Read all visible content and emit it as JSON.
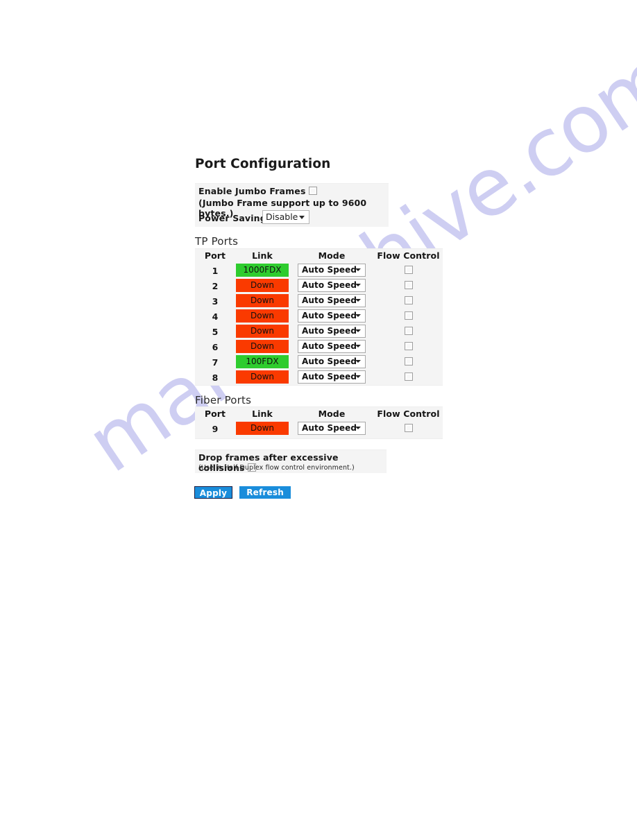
{
  "watermark": {
    "text": "manualshive.com",
    "color": "#ccccf2"
  },
  "page": {
    "title": "Port Configuration"
  },
  "jumbo_panel": {
    "enable_label": "Enable Jumbo Frames",
    "enable_checked": false,
    "note": "(Jumbo Frame support up to 9600 bytes.)",
    "power_saving_label": "Power Saving",
    "power_saving_value": "Disable"
  },
  "tp_section": {
    "heading": "TP Ports",
    "columns": [
      "Port",
      "Link",
      "Mode",
      "Flow Control"
    ],
    "rows": [
      {
        "port": "1",
        "link": "1000FDX",
        "link_state": "up",
        "mode": "Auto Speed",
        "flow_control": false
      },
      {
        "port": "2",
        "link": "Down",
        "link_state": "down",
        "mode": "Auto Speed",
        "flow_control": false
      },
      {
        "port": "3",
        "link": "Down",
        "link_state": "down",
        "mode": "Auto Speed",
        "flow_control": false
      },
      {
        "port": "4",
        "link": "Down",
        "link_state": "down",
        "mode": "Auto Speed",
        "flow_control": false
      },
      {
        "port": "5",
        "link": "Down",
        "link_state": "down",
        "mode": "Auto Speed",
        "flow_control": false
      },
      {
        "port": "6",
        "link": "Down",
        "link_state": "down",
        "mode": "Auto Speed",
        "flow_control": false
      },
      {
        "port": "7",
        "link": "100FDX",
        "link_state": "up",
        "mode": "Auto Speed",
        "flow_control": false
      },
      {
        "port": "8",
        "link": "Down",
        "link_state": "down",
        "mode": "Auto Speed",
        "flow_control": false
      }
    ]
  },
  "fiber_section": {
    "heading": "Fiber Ports",
    "columns": [
      "Port",
      "Link",
      "Mode",
      "Flow Control"
    ],
    "rows": [
      {
        "port": "9",
        "link": "Down",
        "link_state": "down",
        "mode": "Auto Speed",
        "flow_control": false
      }
    ]
  },
  "drop_panel": {
    "label": "Drop frames after excessive collisions",
    "checked": false,
    "note": "(Use in Half Duplex flow control environment.)"
  },
  "buttons": {
    "apply": "Apply",
    "refresh": "Refresh"
  },
  "colors": {
    "link_up": "#2ecc2e",
    "link_down": "#fa3a00",
    "button": "#1a8ddb",
    "panel_bg": "#f4f4f4"
  }
}
